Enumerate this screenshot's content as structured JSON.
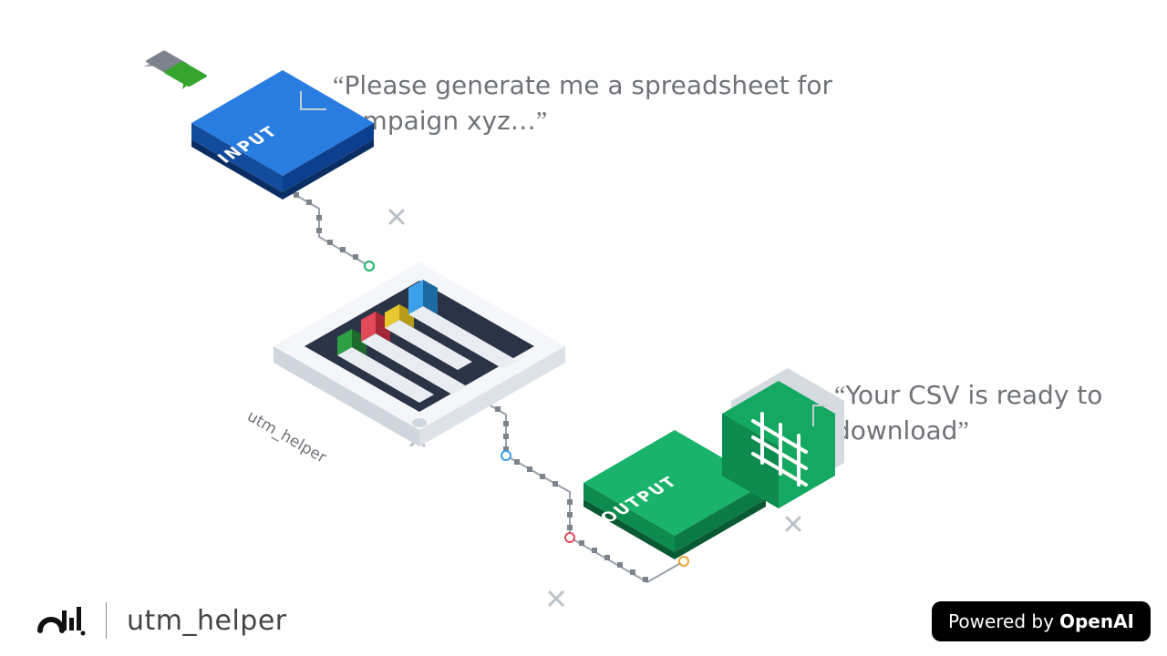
{
  "input": {
    "label": "INPUT",
    "quote": "Please generate me a spreadsheet for campaign xyz…"
  },
  "center": {
    "caption": "utm_helper"
  },
  "output": {
    "label": "OUTPUT",
    "quote": "Your CSV is ready to download"
  },
  "footer": {
    "name": "utm_helper"
  },
  "badge": {
    "prefix": "Powered by",
    "brand": "OpenAI"
  },
  "colors": {
    "blue": "#1f6bd6",
    "blueDark": "#0d3f8f",
    "green": "#19b36b",
    "greenDark": "#0c7a45",
    "grey": "#6f7378",
    "lightGrey": "#b9c0c7",
    "panel": "#2b3446",
    "panelLight": "#3c475d",
    "cream": "#eef1f5",
    "creamShadow": "#d2d8e0",
    "red": "#e24a5a",
    "yellow": "#e8c82f",
    "lightBlue": "#3aa0ea"
  }
}
